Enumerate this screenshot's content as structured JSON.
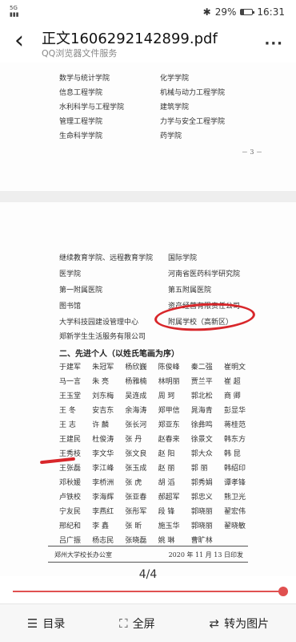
{
  "status": {
    "signal": "5G",
    "battery": "29%",
    "time": "16:31"
  },
  "header": {
    "title": "正文1606292142899.pdf",
    "subtitle": "QQ浏览器文件服务"
  },
  "page1": {
    "rows": [
      [
        "数学与统计学院",
        "化学学院"
      ],
      [
        "信息工程学院",
        "机械与动力工程学院"
      ],
      [
        "水利科学与工程学院",
        "建筑学院"
      ],
      [
        "管理工程学院",
        "力学与安全工程学院"
      ],
      [
        "生命科学学院",
        "药学院"
      ]
    ],
    "page_number": "－ 3 －"
  },
  "page2": {
    "rows": [
      [
        "继续教育学院、远程教育学院",
        "国际学院"
      ],
      [
        "医学院",
        "河南省医药科学研究院"
      ],
      [
        "第一附属医院",
        "第五附属医院"
      ],
      [
        "图书馆",
        "资产经营有限责任公司"
      ],
      [
        "大学科技园建设管理中心",
        "附属学校（高新区）"
      ],
      [
        "郑新学生生活服务有限公司",
        ""
      ]
    ],
    "section_title": "二、先进个人（以姓氏笔画为序）",
    "names": [
      [
        "于建军",
        "朱冠军",
        "杨欣巍",
        "陈俊峰",
        "秦二强",
        "崔明文"
      ],
      [
        "马一言",
        "朱  亮",
        "杨雅楠",
        "林明丽",
        "贾兰平",
        "崔  超"
      ],
      [
        "王玉堂",
        "刘东梅",
        "吴连成",
        "周  珂",
        "郭北松",
        "商  卿"
      ],
      [
        "王  冬",
        "安吉东",
        "余海涛",
        "郑甲信",
        "晁海青",
        "彭显华"
      ],
      [
        "王  志",
        "许  麟",
        "张长河",
        "郑亚东",
        "徐彝鸣",
        "蒋桂范"
      ],
      [
        "王建民",
        "杜俊涛",
        "张  丹",
        "赵春来",
        "徐景文",
        "韩东方"
      ],
      [
        "王秀枝",
        "李文华",
        "张文良",
        "赵  阳",
        "郭大众",
        "韩  昆"
      ],
      [
        "王张磊",
        "李江峰",
        "张玉成",
        "赵  丽",
        "郭  丽",
        "韩绍印"
      ],
      [
        "邓秋媛",
        "李桥洲",
        "张  虎",
        "胡  滔",
        "郭秀娟",
        "谭孝锋"
      ],
      [
        "卢铁校",
        "李海辉",
        "张亚春",
        "郝超军",
        "郭忠义",
        "熊卫光"
      ],
      [
        "宁友民",
        "李燕红",
        "张彤军",
        "段  锋",
        "郭晓丽",
        "翟宏伟"
      ],
      [
        "邢纪和",
        "李  鑫",
        "张  昕",
        "施玉华",
        "郭晓丽",
        "翟晓敏"
      ],
      [
        "吕广振",
        "杨志民",
        "张晓磊",
        "姚  琳",
        "曹旷林",
        ""
      ]
    ],
    "footer_left": "郑州大学校长办公室",
    "footer_right": "2020 年 11 月 13 日印发"
  },
  "pager": {
    "indicator": "4/4",
    "progress_fraction": 1.0
  },
  "toolbar": {
    "toc_label": "目录",
    "fullscreen_label": "全屏",
    "to_image_label": "转为图片"
  },
  "colors": {
    "accent": "#e05050",
    "annotation_red": "#d8262a"
  }
}
